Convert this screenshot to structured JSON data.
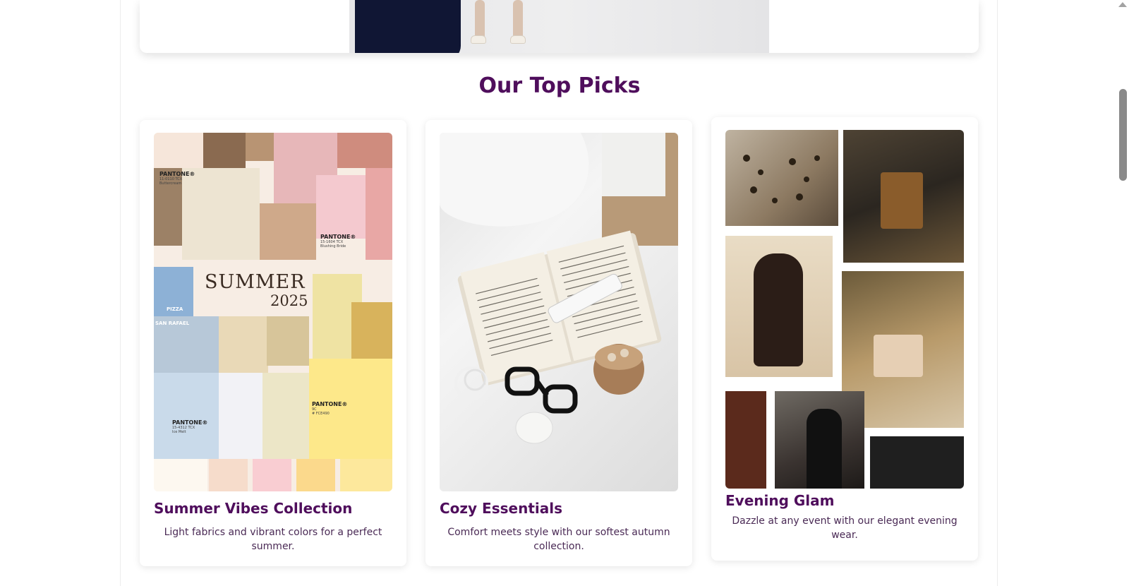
{
  "section": {
    "title": "Our Top Picks"
  },
  "cards": [
    {
      "title": "Summer Vibes Collection",
      "description": "Light fabrics and vibrant colors for a perfect summer.",
      "image": {
        "headline": "SUMMER",
        "year": "2025",
        "pantone_labels": [
          {
            "brand": "PANTONE®",
            "code": "11-0110 TCX",
            "name": "Buttercream"
          },
          {
            "brand": "PANTONE®",
            "code": "15-1604 TCX",
            "name": "Blushing Bride"
          },
          {
            "brand": "PANTONE®",
            "code": "15-4312 TCX",
            "name": "Ice Melt"
          },
          {
            "brand": "PANTONE®",
            "code": "9C",
            "name": "# FCE490"
          }
        ],
        "sign_words": [
          "PIZZA",
          "SAN RAFAEL"
        ],
        "swatches": [
          "#fdf8f0",
          "#f6dccb",
          "#f9cdd2",
          "#fbd98c",
          "#fde89c"
        ]
      }
    },
    {
      "title": "Cozy Essentials",
      "description": "Comfort meets style with our softest autumn collection."
    },
    {
      "title": "Evening Glam",
      "description": "Dazzle at any event with our elegant evening wear."
    }
  ],
  "colors": {
    "heading": "#4f0e5c",
    "text": "#4a2a55",
    "dress": "#101634"
  }
}
